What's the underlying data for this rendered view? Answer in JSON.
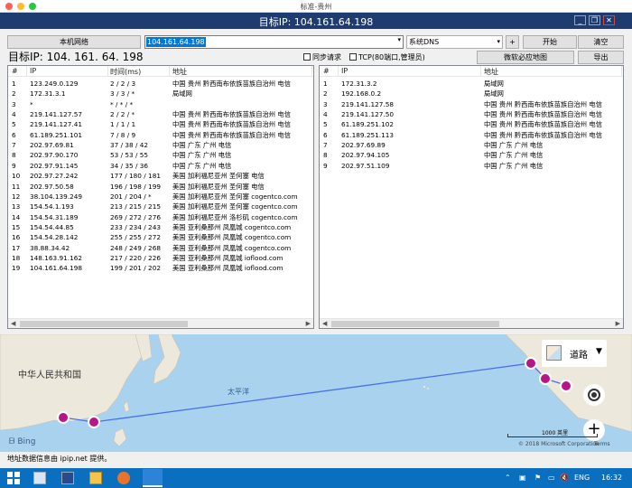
{
  "window": {
    "title": "标准-贵州",
    "app_title": "目标IP: 104.161.64.198"
  },
  "toolbar": {
    "local_network_label": "本机网络",
    "ip_value": "104.161.64.198",
    "dns_select": "系统DNS",
    "add_label": "+",
    "start_label": "开始",
    "clear_label": "清空",
    "target_ip_text": "目标IP:  104. 161. 64. 198",
    "sync_request_label": "同步请求",
    "tcp_label": "TCP(80端口,管理员)",
    "bing_map_label": "微软必应地图",
    "export_label": "导出"
  },
  "left_table": {
    "columns": [
      "#",
      "IP",
      "时间(ms)",
      "地址"
    ],
    "rows": [
      [
        "1",
        "123.249.0.129",
        "2 / 2 / 3",
        "中国 贵州 黔西南布依族苗族自治州 电信"
      ],
      [
        "2",
        "172.31.3.1",
        "3 / 3 / *",
        "局域网"
      ],
      [
        "3",
        "*",
        "* / * / *",
        ""
      ],
      [
        "4",
        "219.141.127.57",
        "2 / 2 / *",
        "中国 贵州 黔西南布依族苗族自治州 电信"
      ],
      [
        "5",
        "219.141.127.41",
        "1 / 1 / 1",
        "中国 贵州 黔西南布依族苗族自治州 电信"
      ],
      [
        "6",
        "61.189.251.101",
        "7 / 8 / 9",
        "中国 贵州 黔西南布依族苗族自治州 电信"
      ],
      [
        "7",
        "202.97.69.81",
        "37 / 38 / 42",
        "中国 广东 广州 电信"
      ],
      [
        "8",
        "202.97.90.170",
        "53 / 53 / 55",
        "中国 广东 广州 电信"
      ],
      [
        "9",
        "202.97.91.145",
        "34 / 35 / 36",
        "中国 广东 广州 电信"
      ],
      [
        "10",
        "202.97.27.242",
        "177 / 180 / 181",
        "美国 加利福尼亚州 圣何塞 电信"
      ],
      [
        "11",
        "202.97.50.58",
        "196 / 198 / 199",
        "美国 加利福尼亚州 圣何塞 电信"
      ],
      [
        "12",
        "38.104.139.249",
        "201 / 204 / *",
        "美国 加利福尼亚州 圣何塞 cogentco.com"
      ],
      [
        "13",
        "154.54.1.193",
        "213 / 215 / 215",
        "美国 加利福尼亚州 圣何塞 cogentco.com"
      ],
      [
        "14",
        "154.54.31.189",
        "269 / 272 / 276",
        "美国 加利福尼亚州 洛杉矶 cogentco.com"
      ],
      [
        "15",
        "154.54.44.85",
        "233 / 234 / 243",
        "美国 亚利桑那州 凤凰城 cogentco.com"
      ],
      [
        "16",
        "154.54.28.142",
        "255 / 255 / 272",
        "美国 亚利桑那州 凤凰城 cogentco.com"
      ],
      [
        "17",
        "38.88.34.42",
        "248 / 249 / 268",
        "美国 亚利桑那州 凤凰城 cogentco.com"
      ],
      [
        "18",
        "148.163.91.162",
        "217 / 220 / 226",
        "美国 亚利桑那州 凤凰城 ioflood.com"
      ],
      [
        "19",
        "104.161.64.198",
        "199 / 201 / 202",
        "美国 亚利桑那州 凤凰城 ioflood.com"
      ]
    ]
  },
  "right_table": {
    "columns": [
      "#",
      "IP",
      "地址"
    ],
    "rows": [
      [
        "1",
        "172.31.3.2",
        "局域网"
      ],
      [
        "2",
        "192.168.0.2",
        "局域网"
      ],
      [
        "3",
        "219.141.127.58",
        "中国 贵州 黔西南布依族苗族自治州 电信"
      ],
      [
        "4",
        "219.141.127.50",
        "中国 贵州 黔西南布依族苗族自治州 电信"
      ],
      [
        "5",
        "61.189.251.102",
        "中国 贵州 黔西南布依族苗族自治州 电信"
      ],
      [
        "6",
        "61.189.251.113",
        "中国 贵州 黔西南布依族苗族自治州 电信"
      ],
      [
        "7",
        "202.97.69.89",
        "中国 广东 广州 电信"
      ],
      [
        "8",
        "202.97.94.105",
        "中国 广东 广州 电信"
      ],
      [
        "9",
        "202.97.51.109",
        "中国 广东 广州 电信"
      ]
    ]
  },
  "map": {
    "country_label": "中华人民共和国",
    "ocean_label": "太平洋",
    "road_label": "道路",
    "scale_label": "1000 英里",
    "copyright": "© 2018 Microsoft Corporation",
    "terms": "Terms",
    "bing": "Bing"
  },
  "footer": {
    "text": "地址数据信息由 ipip.net 提供。"
  },
  "taskbar": {
    "lang": "ENG",
    "time": "16:32"
  },
  "colors": {
    "title_bar": "#1f3c70",
    "selection": "#0078d7",
    "map_water": "#a9d2ee",
    "map_land": "#ede8dc",
    "marker": "#b5178a",
    "route": "#4a6ff0",
    "taskbar": "#0b6fc0"
  }
}
